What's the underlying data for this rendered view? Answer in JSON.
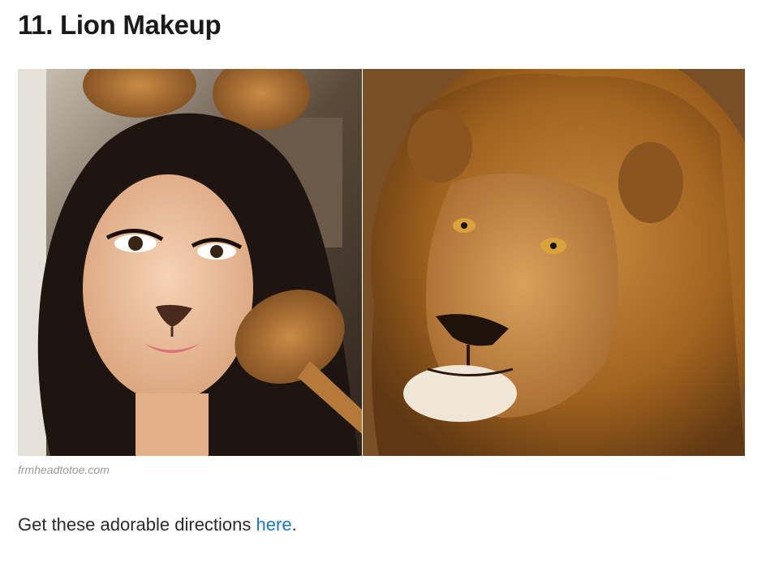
{
  "article": {
    "title": "11. Lion Makeup",
    "image_alt_left": "Woman wearing lion makeup and ears",
    "image_alt_right": "Male lion face",
    "credit": "frmheadtotoe.com",
    "caption": {
      "before": "Get these adorable directions ",
      "link": "here",
      "after": "."
    }
  },
  "colors": {
    "link": "#1f76c2",
    "credit": "#9a9a9a",
    "title": "#1a1a1a"
  }
}
